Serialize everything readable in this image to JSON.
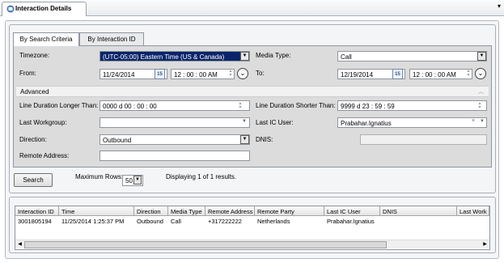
{
  "window": {
    "title": "Interaction Details",
    "menu_glyph": "▾"
  },
  "tabs": [
    {
      "label": "By Search Criteria",
      "active": true
    },
    {
      "label": "By Interaction ID",
      "active": false
    }
  ],
  "form": {
    "timezone_label": "Timezone:",
    "timezone_value": "(UTC-05:00) Eastern Time (US & Canada)",
    "media_type_label": "Media Type:",
    "media_type_value": "Call",
    "from_label": "From:",
    "from_date": "11/24/2014",
    "from_time": "12 : 00  : 00  AM",
    "to_label": "To:",
    "to_date": "12/19/2014",
    "to_time": "12 : 00  : 00  AM",
    "calendar_glyph": "15",
    "advanced_label": "Advanced",
    "line_longer_label": "Line Duration Longer Than:",
    "line_longer_value": "0000 d  00 : 00 : 00",
    "line_shorter_label": "Line Duration Shorter Than:",
    "line_shorter_value": "9999 d  23 : 59 : 59",
    "last_workgroup_label": "Last Workgroup:",
    "last_workgroup_value": "",
    "last_ic_user_label": "Last IC User:",
    "last_ic_user_value": "Prabahar.Ignatius",
    "direction_label": "Direction:",
    "direction_value": "Outbound",
    "dnis_label": "DNIS:",
    "dnis_value": "",
    "remote_address_label": "Remote Address:",
    "remote_address_value": ""
  },
  "search": {
    "button_label": "Search",
    "max_rows_label": "Maximum Rows:",
    "max_rows_value": "50",
    "status_text": "Displaying 1 of 1 results."
  },
  "results": {
    "columns": [
      "Interaction ID",
      "Time",
      "Direction",
      "Media Type",
      "Remote Address",
      "Remote Party",
      "Last IC User",
      "DNIS",
      "Last Work"
    ],
    "rows": [
      [
        "3001805194",
        "11/25/2014 1:25:37 PM",
        "Outbound",
        "Call",
        "+317222222",
        "Netherlands",
        "Prabahar.Ignatius",
        "",
        ""
      ]
    ]
  },
  "colors": {
    "selection": "#0a246a",
    "panel_gray": "#dcdcdc"
  }
}
